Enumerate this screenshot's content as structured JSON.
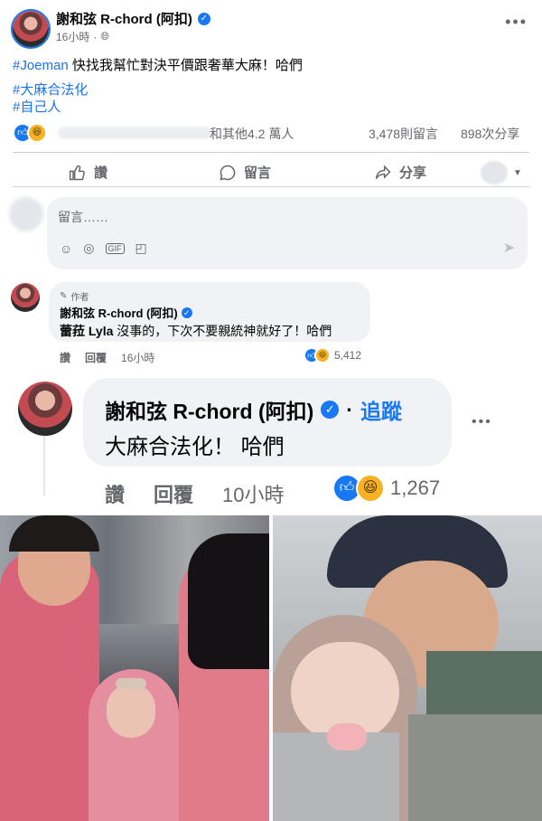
{
  "post": {
    "author": "謝和弦 R-chord (阿扣)",
    "meta_time": "16小時",
    "text_hashtag": "#Joeman",
    "text_main": " 快找我幫忙對決平價跟奢華大麻！哈們",
    "hashtags": [
      "#大麻合法化",
      "#自己人"
    ],
    "reactions_summary": "和其他4.2 萬人",
    "comments_count": "3,478則留言",
    "shares_count": "898次分享",
    "actions": {
      "like": "讚",
      "comment": "留言",
      "share": "分享"
    },
    "comment_placeholder": "留言……"
  },
  "comments": [
    {
      "badge": "作者",
      "author": "謝和弦 R-chord (阿扣)",
      "mention": "蕾菈 Lyla",
      "text": " 沒事的，下次不要親統神就好了！哈們",
      "like": "讚",
      "reply": "回覆",
      "time": "16小時",
      "reactions": "5,412"
    },
    {
      "author": "謝和弦 R-chord (阿扣)",
      "follow": "追蹤",
      "text": "大麻合法化！ 哈們",
      "like": "讚",
      "reply": "回覆",
      "time": "10小時",
      "reactions": "1,267"
    }
  ],
  "colors": {
    "accent": "#1877f2",
    "muted": "#65676b",
    "bubble": "#f0f2f5"
  },
  "icons": [
    "globe-icon",
    "more-icon",
    "like-icon",
    "comment-icon",
    "share-icon",
    "emoji-icon",
    "camera-icon",
    "gif-icon",
    "sticker-icon",
    "send-icon",
    "pencil-icon"
  ]
}
